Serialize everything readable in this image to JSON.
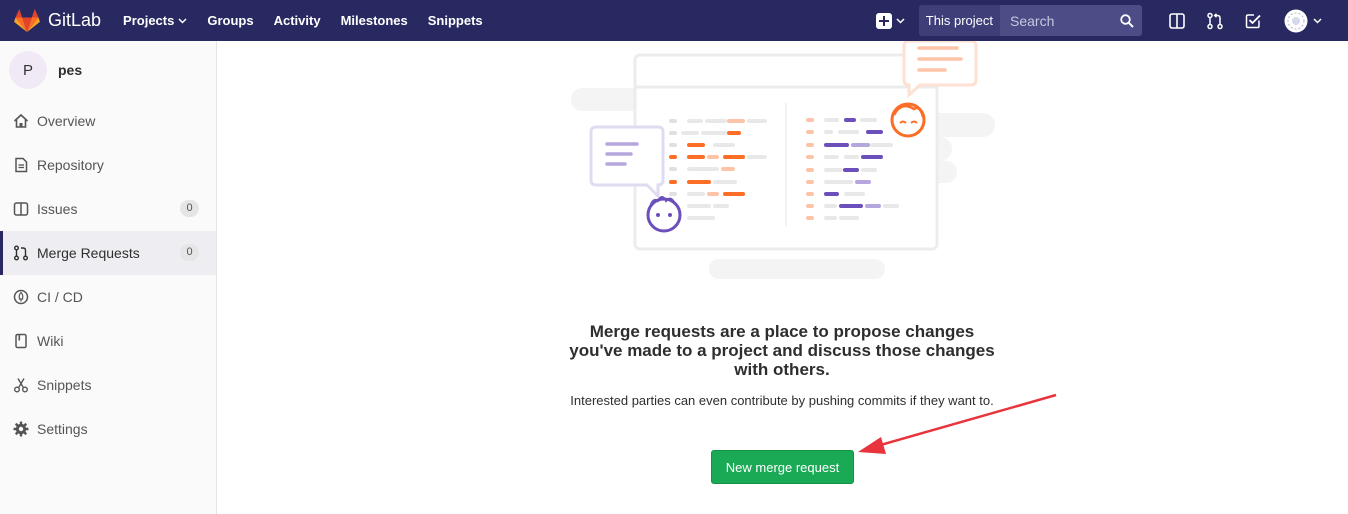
{
  "navbar": {
    "brand": "GitLab",
    "links": [
      {
        "label": "Projects",
        "has_caret": true
      },
      {
        "label": "Groups"
      },
      {
        "label": "Activity"
      },
      {
        "label": "Milestones"
      },
      {
        "label": "Snippets"
      }
    ],
    "search_scope": "This project",
    "search_placeholder": "Search",
    "icons": [
      "plus-icon",
      "issues-icon",
      "merge-request-icon",
      "todo-icon",
      "user-avatar"
    ]
  },
  "sidebar": {
    "project_initial": "P",
    "project_name": "pes",
    "items": [
      {
        "label": "Overview",
        "icon": "home-icon"
      },
      {
        "label": "Repository",
        "icon": "repository-icon"
      },
      {
        "label": "Issues",
        "icon": "issues-icon",
        "badge": "0"
      },
      {
        "label": "Merge Requests",
        "icon": "merge-request-icon",
        "badge": "0",
        "active": true
      },
      {
        "label": "CI / CD",
        "icon": "rocket-icon"
      },
      {
        "label": "Wiki",
        "icon": "book-icon"
      },
      {
        "label": "Snippets",
        "icon": "scissors-icon"
      },
      {
        "label": "Settings",
        "icon": "gear-icon"
      }
    ]
  },
  "empty_state": {
    "title": "Merge requests are a place to propose changes you've made to a project and discuss those changes with others.",
    "description": "Interested parties can even contribute by pushing commits if they want to.",
    "button_label": "New merge request"
  },
  "colors": {
    "navbar": "#292961",
    "primary_button": "#1aaa55",
    "annotation_arrow": "#e8343c",
    "illustration_orange": "#fc6d26",
    "illustration_purple": "#6b4fbb"
  }
}
